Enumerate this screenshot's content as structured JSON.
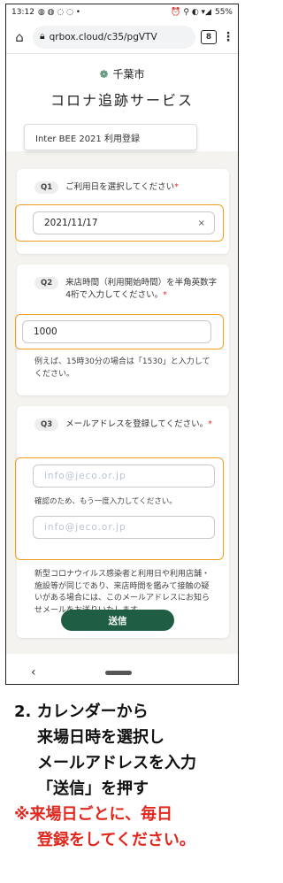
{
  "status_bar": {
    "time": "13:12",
    "notif_icons": "◍ ◍ ◌ ◌ •",
    "right_icons": "⏰ ⚲ ◐ ▾◢",
    "battery": "55%"
  },
  "browser": {
    "url": "qrbox.cloud/c35/pgVTV",
    "tab_count": "8"
  },
  "header": {
    "city": "千葉市",
    "service": "コロナ追跡サービス",
    "event": "Inter BEE 2021 利用登録"
  },
  "q1": {
    "tag": "Q1",
    "text": "ご利用日を選択してください",
    "required_mark": "*",
    "value": "2021/11/17",
    "clear": "×"
  },
  "q2": {
    "tag": "Q2",
    "text": "来店時間（利用開始時間）を半角英数字4桁で入力してください。",
    "required_mark": "*",
    "value": "1000",
    "note": "例えば、15時30分の場合は「1530」と入力してください。"
  },
  "q3": {
    "tag": "Q3",
    "text": "メールアドレスを登録してください。",
    "required_mark": "*",
    "email1": "info@jeco.or.jp",
    "confirm_label": "確認のため、もう一度入力してください。",
    "email2": "info@jeco.or.jp",
    "note": "新型コロナウイルス感染者と利用日や利用店舗・施設等が同じであり、来店時間を鑑みて接触の疑いがある場合には、このメールアドレスにお知らせメールをお送りいたします。"
  },
  "submit_label": "送信",
  "nav": {
    "back": "‹"
  },
  "caption": {
    "line1": "2. カレンダーから",
    "line2": "来場日時を選択し",
    "line3": "メールアドレスを入力",
    "line4": "「送信」を押す",
    "line5": "※来場日ごとに、毎日",
    "line6": "登録をしてください。"
  },
  "colors": {
    "accent_green": "#1f5e42",
    "highlight": "#f0a020",
    "warning_red": "#e0281e"
  }
}
